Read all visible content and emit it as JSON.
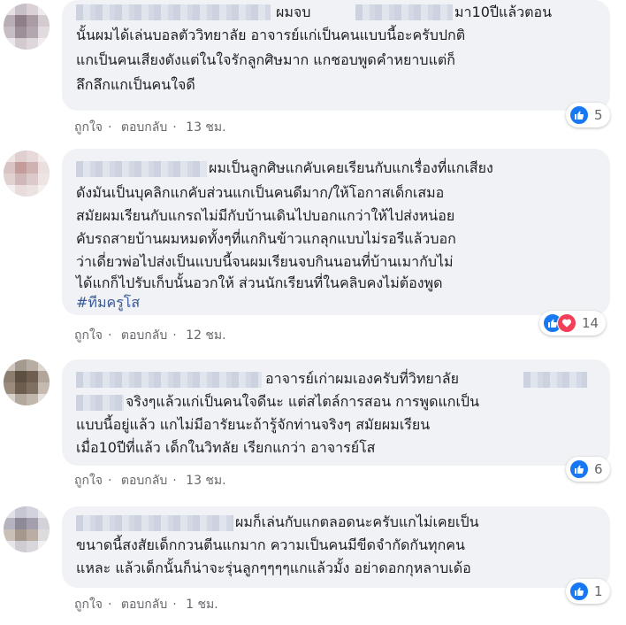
{
  "comments": [
    {
      "lines": [
        "ผมจบ",
        "มา10ปีแล้วตอน",
        "นั้นผมได้เล่นบอลตัววิทยาลัย อาจารย์แก่เป็นคนแบบนี้อะครับปกติ",
        "แกเป็นคนเสียงดังแต่ในใจรักลูกศิษมาก แกชอบพูดคำหยาบแต่ก็",
        "ลึกลึกแกเป็นคนใจดี"
      ],
      "actions": {
        "like": "ถูกใจ",
        "reply": "ตอบกลับ",
        "time": "13 ชม."
      },
      "reaction_count": "5"
    },
    {
      "lines": [
        "ผมเป็นลูกศิษแกคับเคยเรียนกับแกเรื่องที่แกเสียง",
        "ดังมันเป็นบุคลิกแกคับส่วนแกเป็นคนดีมาก/ให้โอกาสเด็กเสมอ",
        "สมัยผมเรียนกับแกรถไม่มีกับบ้านเดินไปบอกแกว่าให้ไปส่งหน่อย",
        "คับรถสายบ้านผมหมดทั้งๆที่แกกินข้าวแกลุกแบบไม่รอรีแล้วบอก",
        "ว่าเดี่ยวพ่อไปส่งเป็นแบบนี้จนผมเรียนจบกินนอนที่บ้านเมากับไม่",
        "ได้แกก็ไปรับเก็บนั้นอวกให้ ส่วนนักเรียนที่ในคลิบคงไม่ต้องพูด"
      ],
      "hashtag": "#ทีมครูโส",
      "actions": {
        "like": "ถูกใจ",
        "reply": "ตอบกลับ",
        "time": "12 ชม."
      },
      "reaction_count": "14"
    },
    {
      "lines": [
        "อาจารย์เก่าผมเองครับที่วิทยาลัย",
        "จริงๆแล้วแก่เป็นคนใจดีนะ แต่สไตล์การสอน การพูดแกเป็น",
        "แบบนี้อยู่แล้ว แกไม่มีอารัยนะถ้ารู้จักท่านจริงๆ สมัยผมเรียน",
        "เมื่อ10ปีที่แล้ว เด็กในวิทลัย เรียกแกว่า อาจารย์โส"
      ],
      "actions": {
        "like": "ถูกใจ",
        "reply": "ตอบกลับ",
        "time": "13 ชม."
      },
      "reaction_count": "6"
    },
    {
      "lines": [
        "ผมก็เล่นกับแกตลอดนะครับแกไม่เคยเป็น",
        "ขนาดนี้สงสัยเด็กกวนตีนแกมาก ความเป็นคนมีขีดจำกัดกันทุกคน",
        "แหละ แล้วเด็กนั้นก็น่าจะรุ่นลูกๆๆๆๆแกแล้วมั้ง อย่าดอกกุหลาบเด้อ"
      ],
      "actions": {
        "like": "ถูกใจ",
        "reply": "ตอบกลับ",
        "time": "1 ชม."
      },
      "reaction_count": "1"
    }
  ],
  "colors": {
    "bubble": "#f0f2f5",
    "like": "#1877f2",
    "love": "#f33e58",
    "link": "#385898",
    "meta": "#65676b"
  },
  "icons": {
    "like": "thumbs-up-icon",
    "love": "heart-icon"
  }
}
